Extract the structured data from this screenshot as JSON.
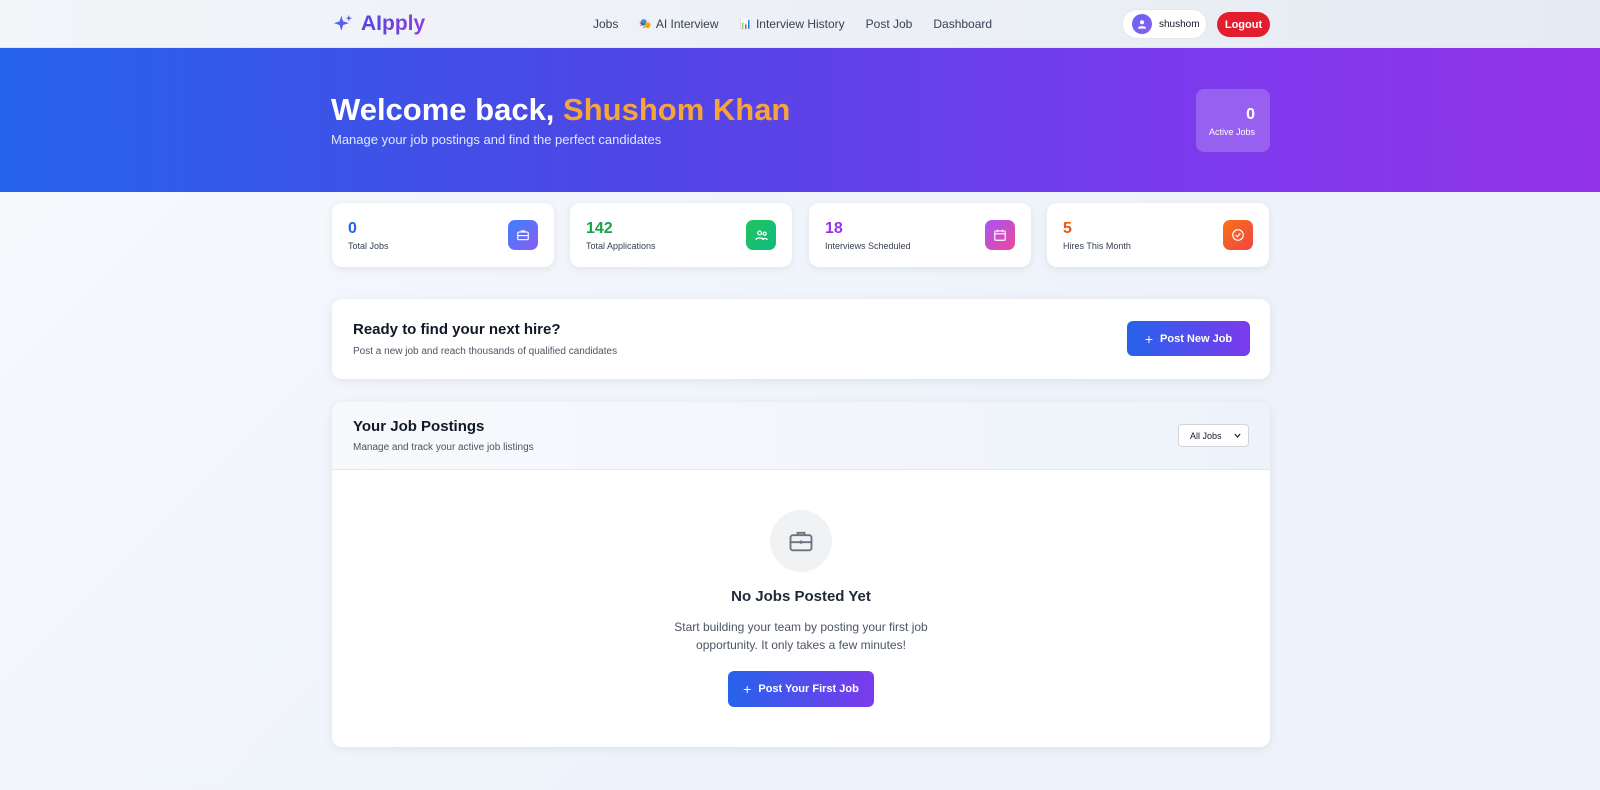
{
  "brand": {
    "name": "AIpply",
    "icon": "sparkle-icon"
  },
  "nav": {
    "links": [
      {
        "label": "Jobs",
        "icon": ""
      },
      {
        "label": "AI Interview",
        "icon": "🎭"
      },
      {
        "label": "Interview History",
        "icon": "📊"
      },
      {
        "label": "Post Job",
        "icon": ""
      },
      {
        "label": "Dashboard",
        "icon": ""
      }
    ],
    "user": "shushom",
    "logout": "Logout"
  },
  "hero": {
    "greeting": "Welcome back, ",
    "name": "Shushom Khan",
    "subtitle": "Manage your job postings and find the perfect candidates",
    "active_jobs_value": "0",
    "active_jobs_label": "Active Jobs"
  },
  "stats": [
    {
      "value": "0",
      "label": "Total Jobs",
      "color": "#2563eb",
      "icon": "briefcase-icon"
    },
    {
      "value": "142",
      "label": "Total Applications",
      "color": "#16a34a",
      "icon": "users-icon"
    },
    {
      "value": "18",
      "label": "Interviews Scheduled",
      "color": "#9333ea",
      "icon": "calendar-icon"
    },
    {
      "value": "5",
      "label": "Hires This Month",
      "color": "#ea580c",
      "icon": "check-circle-icon"
    }
  ],
  "cta": {
    "title": "Ready to find your next hire?",
    "subtitle": "Post a new job and reach thousands of qualified candidates",
    "button": "Post New Job"
  },
  "postings": {
    "title": "Your Job Postings",
    "subtitle": "Manage and track your active job listings",
    "filter": "All Jobs",
    "empty_title": "No Jobs Posted Yet",
    "empty_sub": "Start building your team by posting your first job opportunity. It only takes a few minutes!",
    "empty_button": "Post Your First Job"
  }
}
